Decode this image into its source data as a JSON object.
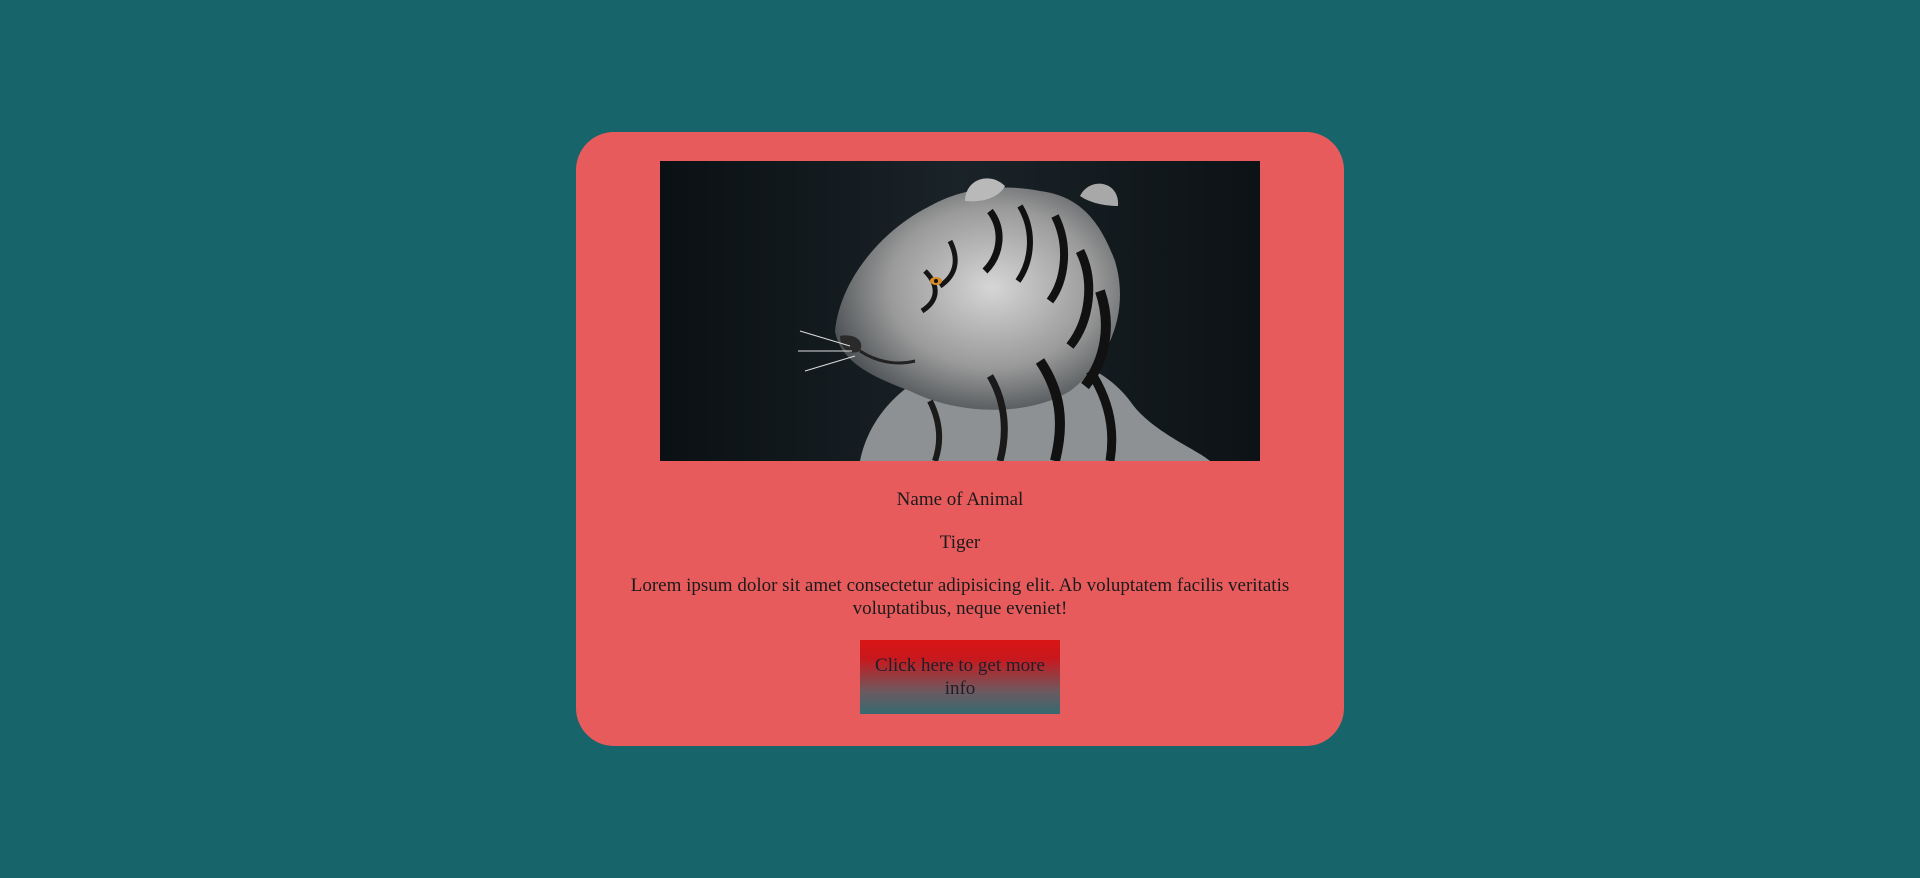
{
  "card": {
    "image": {
      "subject": "tiger",
      "icon": "tiger-photo"
    },
    "name_label": "Name of Animal",
    "name_value": "Tiger",
    "description": "Lorem ipsum dolor sit amet consectetur adipisicing elit. Ab voluptatem facilis veritatis voluptatibus, neque eveniet!",
    "button_label": "Click here to get more info"
  },
  "colors": {
    "page_background": "#17646a",
    "card_background": "#e85b5d",
    "button_gradient_top": "#d91414",
    "button_gradient_bottom": "#356a70",
    "text": "#1a1a1a"
  }
}
